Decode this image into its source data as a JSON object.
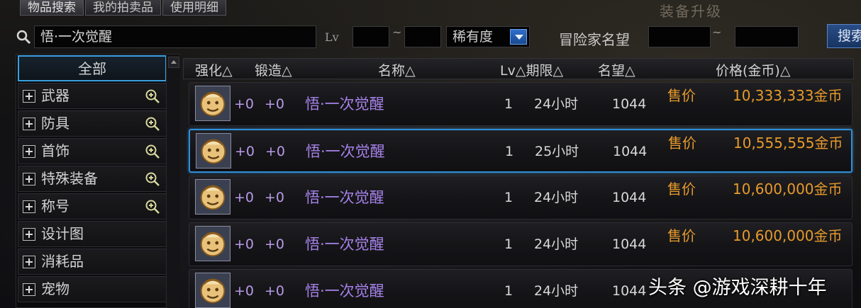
{
  "tabs": [
    "物品搜索",
    "我的拍卖品",
    "使用明细"
  ],
  "bg_text": "装备升级",
  "search": {
    "value": "悟·一次觉醒",
    "lv_label": "Lv",
    "tilde": "~",
    "rarity_label": "稀有度",
    "adventurer_label": "冒险家名望",
    "adventurer_tilde": "~",
    "button_label": "搜索"
  },
  "sidebar": {
    "items": [
      {
        "label": "全部",
        "selected": true,
        "zoom": false
      },
      {
        "label": "武器",
        "selected": false,
        "zoom": true
      },
      {
        "label": "防具",
        "selected": false,
        "zoom": true
      },
      {
        "label": "首饰",
        "selected": false,
        "zoom": true
      },
      {
        "label": "特殊装备",
        "selected": false,
        "zoom": true
      },
      {
        "label": "称号",
        "selected": false,
        "zoom": true
      },
      {
        "label": "设计图",
        "selected": false,
        "zoom": false
      },
      {
        "label": "消耗品",
        "selected": false,
        "zoom": false
      },
      {
        "label": "宠物",
        "selected": false,
        "zoom": false
      }
    ]
  },
  "table": {
    "headers": {
      "strength": "强化△",
      "forge": "锻造△",
      "name": "名称△",
      "lv_period": "Lv△期限△",
      "fame": "名望△",
      "price": "价格(金币)△"
    },
    "rows": [
      {
        "strength": "+0",
        "forge": "+0",
        "name": "悟·一次觉醒",
        "lv": "1",
        "period": "24小时",
        "fame": "1044",
        "sale": "售价",
        "price": "10,333,333金币",
        "selected": false
      },
      {
        "strength": "+0",
        "forge": "+0",
        "name": "悟·一次觉醒",
        "lv": "1",
        "period": "25小时",
        "fame": "1044",
        "sale": "售价",
        "price": "10,555,555金币",
        "selected": true
      },
      {
        "strength": "+0",
        "forge": "+0",
        "name": "悟·一次觉醒",
        "lv": "1",
        "period": "24小时",
        "fame": "1044",
        "sale": "售价",
        "price": "10,600,000金币",
        "selected": false
      },
      {
        "strength": "+0",
        "forge": "+0",
        "name": "悟·一次觉醒",
        "lv": "1",
        "period": "24小时",
        "fame": "1044",
        "sale": "售价",
        "price": "10,600,000金币",
        "selected": false
      },
      {
        "strength": "+0",
        "forge": "+0",
        "name": "悟·一次觉醒",
        "lv": "1",
        "period": "24小时",
        "fame": "1044",
        "sale": "",
        "price": "",
        "selected": false
      }
    ]
  },
  "watermark": "头条 @游戏深耕十年",
  "colors": {
    "name_purple": "#a782ea",
    "price_orange": "#e79a2a",
    "select_blue": "#2f8fd6"
  }
}
